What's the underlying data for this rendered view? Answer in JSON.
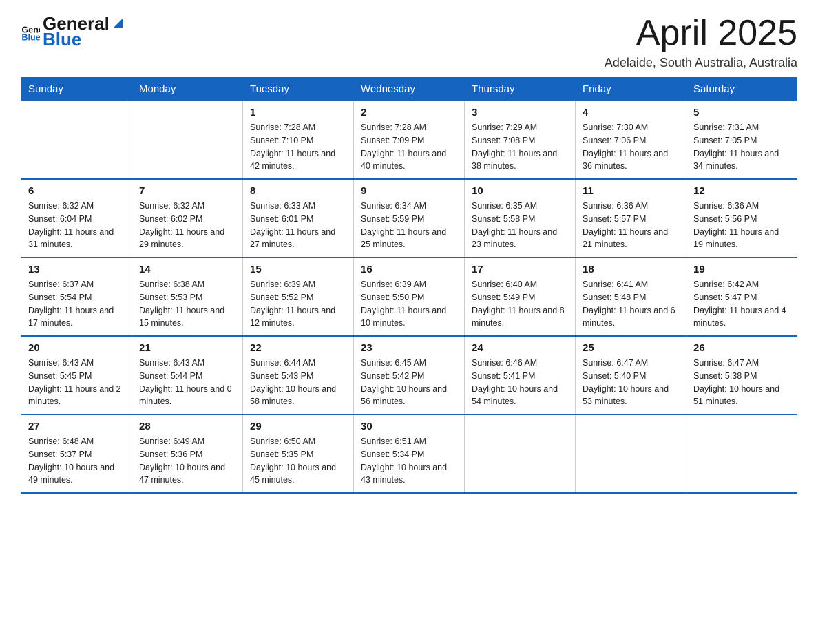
{
  "header": {
    "logo_general": "General",
    "logo_blue": "Blue",
    "month_title": "April 2025",
    "location": "Adelaide, South Australia, Australia"
  },
  "weekdays": [
    "Sunday",
    "Monday",
    "Tuesday",
    "Wednesday",
    "Thursday",
    "Friday",
    "Saturday"
  ],
  "weeks": [
    [
      {
        "day": "",
        "info": ""
      },
      {
        "day": "",
        "info": ""
      },
      {
        "day": "1",
        "info": "Sunrise: 7:28 AM\nSunset: 7:10 PM\nDaylight: 11 hours\nand 42 minutes."
      },
      {
        "day": "2",
        "info": "Sunrise: 7:28 AM\nSunset: 7:09 PM\nDaylight: 11 hours\nand 40 minutes."
      },
      {
        "day": "3",
        "info": "Sunrise: 7:29 AM\nSunset: 7:08 PM\nDaylight: 11 hours\nand 38 minutes."
      },
      {
        "day": "4",
        "info": "Sunrise: 7:30 AM\nSunset: 7:06 PM\nDaylight: 11 hours\nand 36 minutes."
      },
      {
        "day": "5",
        "info": "Sunrise: 7:31 AM\nSunset: 7:05 PM\nDaylight: 11 hours\nand 34 minutes."
      }
    ],
    [
      {
        "day": "6",
        "info": "Sunrise: 6:32 AM\nSunset: 6:04 PM\nDaylight: 11 hours\nand 31 minutes."
      },
      {
        "day": "7",
        "info": "Sunrise: 6:32 AM\nSunset: 6:02 PM\nDaylight: 11 hours\nand 29 minutes."
      },
      {
        "day": "8",
        "info": "Sunrise: 6:33 AM\nSunset: 6:01 PM\nDaylight: 11 hours\nand 27 minutes."
      },
      {
        "day": "9",
        "info": "Sunrise: 6:34 AM\nSunset: 5:59 PM\nDaylight: 11 hours\nand 25 minutes."
      },
      {
        "day": "10",
        "info": "Sunrise: 6:35 AM\nSunset: 5:58 PM\nDaylight: 11 hours\nand 23 minutes."
      },
      {
        "day": "11",
        "info": "Sunrise: 6:36 AM\nSunset: 5:57 PM\nDaylight: 11 hours\nand 21 minutes."
      },
      {
        "day": "12",
        "info": "Sunrise: 6:36 AM\nSunset: 5:56 PM\nDaylight: 11 hours\nand 19 minutes."
      }
    ],
    [
      {
        "day": "13",
        "info": "Sunrise: 6:37 AM\nSunset: 5:54 PM\nDaylight: 11 hours\nand 17 minutes."
      },
      {
        "day": "14",
        "info": "Sunrise: 6:38 AM\nSunset: 5:53 PM\nDaylight: 11 hours\nand 15 minutes."
      },
      {
        "day": "15",
        "info": "Sunrise: 6:39 AM\nSunset: 5:52 PM\nDaylight: 11 hours\nand 12 minutes."
      },
      {
        "day": "16",
        "info": "Sunrise: 6:39 AM\nSunset: 5:50 PM\nDaylight: 11 hours\nand 10 minutes."
      },
      {
        "day": "17",
        "info": "Sunrise: 6:40 AM\nSunset: 5:49 PM\nDaylight: 11 hours\nand 8 minutes."
      },
      {
        "day": "18",
        "info": "Sunrise: 6:41 AM\nSunset: 5:48 PM\nDaylight: 11 hours\nand 6 minutes."
      },
      {
        "day": "19",
        "info": "Sunrise: 6:42 AM\nSunset: 5:47 PM\nDaylight: 11 hours\nand 4 minutes."
      }
    ],
    [
      {
        "day": "20",
        "info": "Sunrise: 6:43 AM\nSunset: 5:45 PM\nDaylight: 11 hours\nand 2 minutes."
      },
      {
        "day": "21",
        "info": "Sunrise: 6:43 AM\nSunset: 5:44 PM\nDaylight: 11 hours\nand 0 minutes."
      },
      {
        "day": "22",
        "info": "Sunrise: 6:44 AM\nSunset: 5:43 PM\nDaylight: 10 hours\nand 58 minutes."
      },
      {
        "day": "23",
        "info": "Sunrise: 6:45 AM\nSunset: 5:42 PM\nDaylight: 10 hours\nand 56 minutes."
      },
      {
        "day": "24",
        "info": "Sunrise: 6:46 AM\nSunset: 5:41 PM\nDaylight: 10 hours\nand 54 minutes."
      },
      {
        "day": "25",
        "info": "Sunrise: 6:47 AM\nSunset: 5:40 PM\nDaylight: 10 hours\nand 53 minutes."
      },
      {
        "day": "26",
        "info": "Sunrise: 6:47 AM\nSunset: 5:38 PM\nDaylight: 10 hours\nand 51 minutes."
      }
    ],
    [
      {
        "day": "27",
        "info": "Sunrise: 6:48 AM\nSunset: 5:37 PM\nDaylight: 10 hours\nand 49 minutes."
      },
      {
        "day": "28",
        "info": "Sunrise: 6:49 AM\nSunset: 5:36 PM\nDaylight: 10 hours\nand 47 minutes."
      },
      {
        "day": "29",
        "info": "Sunrise: 6:50 AM\nSunset: 5:35 PM\nDaylight: 10 hours\nand 45 minutes."
      },
      {
        "day": "30",
        "info": "Sunrise: 6:51 AM\nSunset: 5:34 PM\nDaylight: 10 hours\nand 43 minutes."
      },
      {
        "day": "",
        "info": ""
      },
      {
        "day": "",
        "info": ""
      },
      {
        "day": "",
        "info": ""
      }
    ]
  ]
}
